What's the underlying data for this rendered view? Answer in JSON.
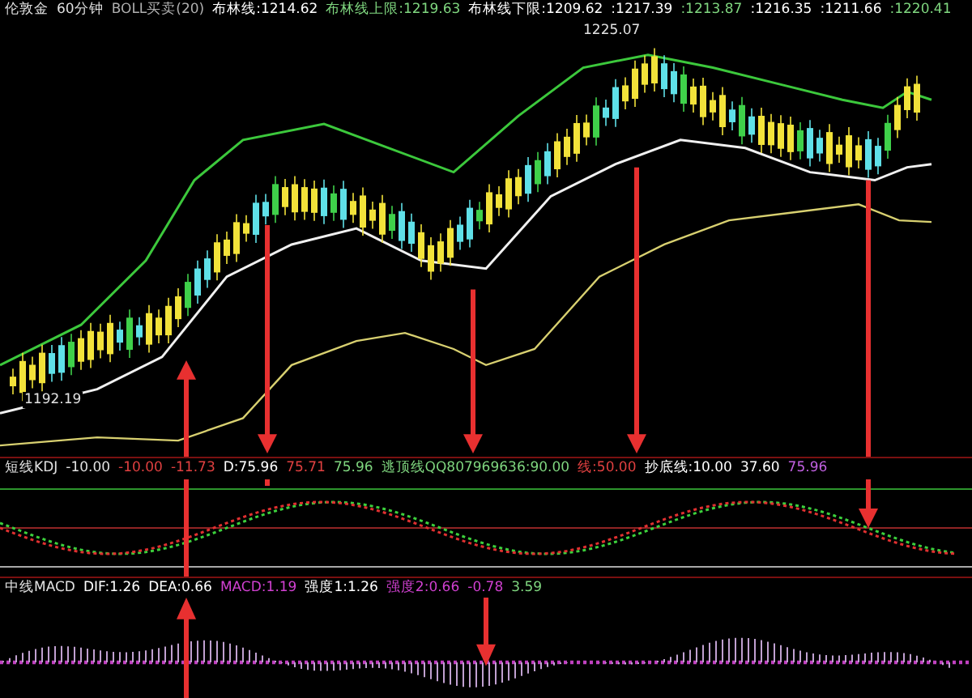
{
  "main_header": [
    {
      "text": "伦敦金",
      "color": "#e0e0e0"
    },
    {
      "text": "60分钟",
      "color": "#e0e0e0"
    },
    {
      "text": "BOLL买卖(20)",
      "color": "#b0b0b0"
    },
    {
      "text": "布林线:1214.62",
      "color": "#ffffff"
    },
    {
      "text": "布林线上限:1219.63",
      "color": "#7fd67f"
    },
    {
      "text": "布林线下限:1209.62",
      "color": "#ffffff"
    },
    {
      "text": ":1217.39",
      "color": "#ffffff"
    },
    {
      "text": ":1213.87",
      "color": "#7fd67f"
    },
    {
      "text": ":1216.35",
      "color": "#ffffff"
    },
    {
      "text": ":1211.66",
      "color": "#ffffff"
    },
    {
      "text": ":1220.41",
      "color": "#7fd67f"
    }
  ],
  "high_label": "1225.07",
  "low_label": "1192.19",
  "kdj_header": [
    {
      "text": "短线KDJ",
      "color": "#e0e0e0"
    },
    {
      "text": "-10.00",
      "color": "#e0e0e0"
    },
    {
      "text": "-10.00",
      "color": "#e04040"
    },
    {
      "text": "-11.73",
      "color": "#e04040"
    },
    {
      "text": "D:75.96",
      "color": "#ffffff"
    },
    {
      "text": "75.71",
      "color": "#e04040"
    },
    {
      "text": "75.96",
      "color": "#7fd67f"
    },
    {
      "text": "逃顶线QQ807969636:90.00",
      "color": "#7fd67f"
    },
    {
      "text": "线:50.00",
      "color": "#e04040"
    },
    {
      "text": "抄底线:10.00",
      "color": "#ffffff"
    },
    {
      "text": "37.60",
      "color": "#ffffff"
    },
    {
      "text": "75.96",
      "color": "#c060e0"
    }
  ],
  "macd_header": [
    {
      "text": "中线MACD",
      "color": "#e0e0e0"
    },
    {
      "text": "DIF:1.26",
      "color": "#ffffff"
    },
    {
      "text": "DEA:0.66",
      "color": "#ffffff"
    },
    {
      "text": "MACD:1.19",
      "color": "#d040d0"
    },
    {
      "text": "强度1:1.26",
      "color": "#ffffff"
    },
    {
      "text": "强度2:0.66",
      "color": "#d040d0"
    },
    {
      "text": "-0.78",
      "color": "#d040d0"
    },
    {
      "text": "3.59",
      "color": "#7fd67f"
    }
  ]
}
